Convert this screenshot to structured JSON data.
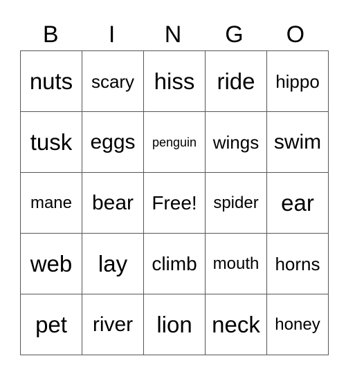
{
  "header": [
    "B",
    "I",
    "N",
    "G",
    "O"
  ],
  "rows": [
    [
      "nuts",
      "scary",
      "hiss",
      "ride",
      "hippo"
    ],
    [
      "tusk",
      "eggs",
      "penguin",
      "wings",
      "swim"
    ],
    [
      "mane",
      "bear",
      "Free!",
      "spider",
      "ear"
    ],
    [
      "web",
      "lay",
      "climb",
      "mouth",
      "horns"
    ],
    [
      "pet",
      "river",
      "lion",
      "neck",
      "honey"
    ]
  ]
}
